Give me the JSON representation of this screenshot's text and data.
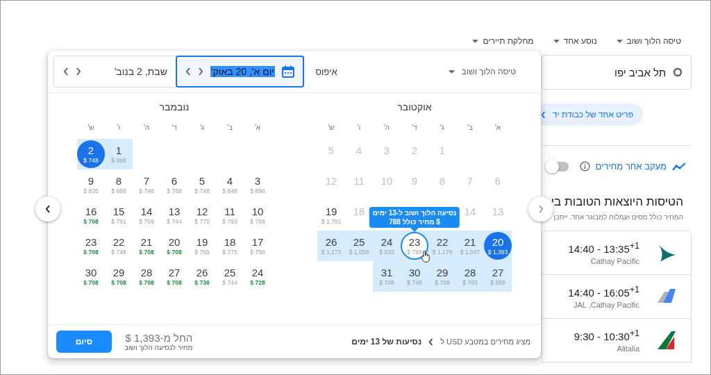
{
  "top_bar": {
    "dropdowns": [
      {
        "label": "טיסה הלוך ושוב"
      },
      {
        "label": "נוסע אחד"
      },
      {
        "label": "מחלקת תיירים"
      }
    ]
  },
  "origin": {
    "value": "תל אביב יפו"
  },
  "bag_chip": {
    "label": "פריט אחד של כבודת יד"
  },
  "price_tracking": {
    "label": "מעקב אחר מחירים",
    "on": false
  },
  "results": {
    "heading": "הטיסות היוצאות הטובות בי",
    "subtitle": "המחיר כולל מסים ועמלות למבוגר אחד. ייתכן",
    "flights": [
      {
        "times": "14:40 - 13:35$^{+1}$",
        "airline": "Cathay Pacific",
        "kind": "swoosh"
      },
      {
        "times": "14:40 - 16:05$^{+1}$",
        "airline": "JAL ,Cathay Pacific",
        "kind": "tail"
      },
      {
        "times": "9:30 - 10:30$^{+1}$",
        "airline": "Alitalia",
        "kind": "stripes"
      }
    ]
  },
  "popup": {
    "trip_type": "טיסה הלוך ושוב",
    "reset": "איפוס",
    "date_fields": [
      {
        "value": "יום א', 20 באוק'",
        "selected": true
      },
      {
        "value": "שבת, 2 בנוב'",
        "selected": false
      }
    ],
    "months": [
      {
        "title": "אוקטובר",
        "weekdays": [
          "א'",
          "ב'",
          "ג'",
          "ד'",
          "ה'",
          "ו'",
          "ש'"
        ],
        "weeks": [
          [
            {
              "day": "5",
              "selected": false,
              "in_range": false,
              "disabled": true,
              "hovered": false
            },
            {
              "day": "4",
              "selected": false,
              "in_range": false,
              "disabled": true,
              "hovered": false
            },
            {
              "day": "3",
              "selected": false,
              "in_range": false,
              "disabled": true,
              "hovered": false
            },
            {
              "day": "2",
              "selected": false,
              "in_range": false,
              "disabled": true,
              "hovered": false
            },
            {
              "day": "1",
              "selected": false,
              "in_range": false,
              "disabled": true,
              "hovered": false
            }
          ],
          [
            {
              "day": "12",
              "selected": false,
              "in_range": false,
              "disabled": true,
              "hovered": false
            },
            {
              "day": "11",
              "selected": false,
              "in_range": false,
              "disabled": true,
              "hovered": false
            },
            {
              "day": "10",
              "selected": false,
              "in_range": false,
              "disabled": true,
              "hovered": false
            },
            {
              "day": "9",
              "selected": false,
              "in_range": false,
              "disabled": true,
              "hovered": false
            },
            {
              "day": "8",
              "selected": false,
              "in_range": false,
              "disabled": true,
              "hovered": false
            },
            {
              "day": "7",
              "selected": false,
              "in_range": false,
              "disabled": true,
              "hovered": false
            },
            {
              "day": "6",
              "selected": false,
              "in_range": false,
              "disabled": true,
              "hovered": false
            }
          ],
          [
            {
              "day": "19",
              "price": "$ 1,781",
              "low_price": false,
              "selected": false,
              "in_range": false,
              "disabled": false,
              "hovered": false
            },
            {
              "day": "18",
              "selected": false,
              "in_range": false,
              "disabled": true,
              "hovered": false
            },
            {
              "day": "14",
              "selected": false,
              "in_range": false,
              "disabled": true,
              "hovered": false
            },
            {
              "day": "13",
              "selected": false,
              "in_range": false,
              "disabled": true,
              "hovered": false
            }
          ],
          [
            {
              "day": "26",
              "price": "$ 1,173",
              "low_price": false,
              "selected": false,
              "in_range": true,
              "disabled": false,
              "hovered": false
            },
            {
              "day": "25",
              "price": "$ 1,058",
              "low_price": false,
              "selected": false,
              "in_range": true,
              "disabled": false,
              "hovered": false
            },
            {
              "day": "24",
              "price": "$ 933",
              "low_price": false,
              "selected": false,
              "in_range": true,
              "disabled": false,
              "hovered": false
            },
            {
              "day": "23",
              "price": "$ 788",
              "low_price": false,
              "selected": false,
              "in_range": true,
              "disabled": false,
              "hovered": true
            },
            {
              "day": "22",
              "price": "$ 1,179",
              "low_price": false,
              "selected": false,
              "in_range": true,
              "disabled": false,
              "hovered": false
            },
            {
              "day": "21",
              "price": "$ 1,047",
              "low_price": false,
              "selected": false,
              "in_range": true,
              "disabled": false,
              "hovered": false
            },
            {
              "day": "20",
              "price": "$ 1,393",
              "low_price": false,
              "selected": true,
              "in_range": true,
              "disabled": false,
              "hovered": false
            }
          ],
          [
            {
              "day": "31",
              "price": "$ 748",
              "low_price": false,
              "selected": false,
              "in_range": true,
              "disabled": false,
              "hovered": false
            },
            {
              "day": "30",
              "price": "$ 748",
              "low_price": false,
              "selected": false,
              "in_range": true,
              "disabled": false,
              "hovered": false
            },
            {
              "day": "29",
              "price": "$ 768",
              "low_price": false,
              "selected": false,
              "in_range": true,
              "disabled": false,
              "hovered": false
            },
            {
              "day": "28",
              "price": "$ 793",
              "low_price": false,
              "selected": false,
              "in_range": true,
              "disabled": false,
              "hovered": false
            },
            {
              "day": "27",
              "price": "$ 868",
              "low_price": false,
              "selected": false,
              "in_range": true,
              "disabled": false,
              "hovered": false
            }
          ]
        ]
      },
      {
        "title": "נובמבר",
        "weekdays": [
          "א'",
          "ב'",
          "ג'",
          "ד'",
          "ה'",
          "ו'",
          "ש'"
        ],
        "weeks": [
          [
            {
              "day": "2",
              "price": "$ 748",
              "low_price": false,
              "selected": true,
              "in_range": true,
              "disabled": false,
              "hovered": false
            },
            {
              "day": "1",
              "price": "$ 868",
              "low_price": false,
              "selected": false,
              "in_range": true,
              "disabled": false,
              "hovered": false
            }
          ],
          [
            {
              "day": "9",
              "price": "$ 835",
              "low_price": false,
              "selected": false,
              "in_range": false,
              "disabled": false,
              "hovered": false
            },
            {
              "day": "8",
              "price": "$ 868",
              "low_price": false,
              "selected": false,
              "in_range": false,
              "disabled": false,
              "hovered": false
            },
            {
              "day": "7",
              "price": "$ 748",
              "low_price": false,
              "selected": false,
              "in_range": false,
              "disabled": false,
              "hovered": false
            },
            {
              "day": "6",
              "price": "$ 768",
              "low_price": false,
              "selected": false,
              "in_range": false,
              "disabled": false,
              "hovered": false
            },
            {
              "day": "5",
              "price": "$ 748",
              "low_price": false,
              "selected": false,
              "in_range": false,
              "disabled": false,
              "hovered": false
            },
            {
              "day": "4",
              "price": "$ 848",
              "low_price": false,
              "selected": false,
              "in_range": false,
              "disabled": false,
              "hovered": false
            },
            {
              "day": "3",
              "price": "$ 898",
              "low_price": false,
              "selected": false,
              "in_range": false,
              "disabled": false,
              "hovered": false
            }
          ],
          [
            {
              "day": "16",
              "price": "$ 708",
              "low_price": true,
              "selected": false,
              "in_range": false,
              "disabled": false,
              "hovered": false
            },
            {
              "day": "15",
              "price": "$ 791",
              "low_price": false,
              "selected": false,
              "in_range": false,
              "disabled": false,
              "hovered": false
            },
            {
              "day": "14",
              "price": "$ 759",
              "low_price": false,
              "selected": false,
              "in_range": false,
              "disabled": false,
              "hovered": false
            },
            {
              "day": "13",
              "price": "$ 744",
              "low_price": false,
              "selected": false,
              "in_range": false,
              "disabled": false,
              "hovered": false
            },
            {
              "day": "12",
              "price": "$ 775",
              "low_price": false,
              "selected": false,
              "in_range": false,
              "disabled": false,
              "hovered": false
            },
            {
              "day": "11",
              "price": "$ 793",
              "low_price": false,
              "selected": false,
              "in_range": false,
              "disabled": false,
              "hovered": false
            },
            {
              "day": "10",
              "price": "$ 788",
              "low_price": false,
              "selected": false,
              "in_range": false,
              "disabled": false,
              "hovered": false
            }
          ],
          [
            {
              "day": "23",
              "price": "$ 708",
              "low_price": true,
              "selected": false,
              "in_range": false,
              "disabled": false,
              "hovered": false
            },
            {
              "day": "22",
              "price": "$ 748",
              "low_price": false,
              "selected": false,
              "in_range": false,
              "disabled": false,
              "hovered": false
            },
            {
              "day": "21",
              "price": "$ 708",
              "low_price": true,
              "selected": false,
              "in_range": false,
              "disabled": false,
              "hovered": false
            },
            {
              "day": "20",
              "price": "$ 708",
              "low_price": true,
              "selected": false,
              "in_range": false,
              "disabled": false,
              "hovered": false
            },
            {
              "day": "19",
              "price": "$ 765",
              "low_price": false,
              "selected": false,
              "in_range": false,
              "disabled": false,
              "hovered": false
            },
            {
              "day": "18",
              "price": "$ 775",
              "low_price": false,
              "selected": false,
              "in_range": false,
              "disabled": false,
              "hovered": false
            },
            {
              "day": "17",
              "price": "$ 798",
              "low_price": false,
              "selected": false,
              "in_range": false,
              "disabled": false,
              "hovered": false
            }
          ],
          [
            {
              "day": "30",
              "price": "$ 708",
              "low_price": true,
              "selected": false,
              "in_range": false,
              "disabled": false,
              "hovered": false
            },
            {
              "day": "29",
              "price": "$ 708",
              "low_price": true,
              "selected": false,
              "in_range": false,
              "disabled": false,
              "hovered": false
            },
            {
              "day": "28",
              "price": "$ 708",
              "low_price": true,
              "selected": false,
              "in_range": false,
              "disabled": false,
              "hovered": false
            },
            {
              "day": "27",
              "price": "$ 708",
              "low_price": true,
              "selected": false,
              "in_range": false,
              "disabled": false,
              "hovered": false
            },
            {
              "day": "26",
              "price": "$ 736",
              "low_price": true,
              "selected": false,
              "in_range": false,
              "disabled": false,
              "hovered": false
            },
            {
              "day": "25",
              "price": "$ 744",
              "low_price": false,
              "selected": false,
              "in_range": false,
              "disabled": false,
              "hovered": false
            },
            {
              "day": "24",
              "price": "$ 728",
              "low_price": true,
              "selected": false,
              "in_range": false,
              "disabled": false,
              "hovered": false
            }
          ]
        ]
      }
    ],
    "tooltip": {
      "line_1": "נסיעה הלוך ושוב ל-13 ימים",
      "line_2": "מחיר כולל 788 $"
    },
    "footer": {
      "currency_note": "מציג מחירים במטבע USD ל",
      "trip_length": "נסיעות של 13 ימים",
      "price_from": "החל מ-1,393 $",
      "price_note": "מחיר לנסיעה הלוך ושוב",
      "done": "סיום"
    }
  }
}
